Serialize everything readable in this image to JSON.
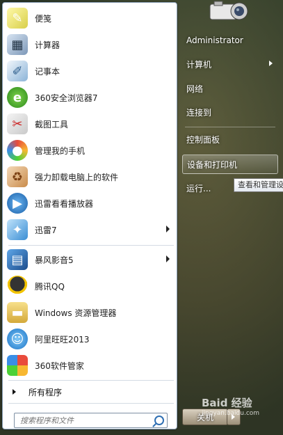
{
  "user": {
    "name": "Administrator"
  },
  "programs": [
    {
      "label": "便笺",
      "icon": "sticky-note-icon"
    },
    {
      "label": "计算器",
      "icon": "calculator-icon"
    },
    {
      "label": "记事本",
      "icon": "notepad-icon"
    },
    {
      "label": "360安全浏览器7",
      "icon": "browser-360-icon"
    },
    {
      "label": "截图工具",
      "icon": "snipping-tool-icon"
    },
    {
      "label": "管理我的手机",
      "icon": "phone-manager-icon"
    },
    {
      "label": "强力卸载电脑上的软件",
      "icon": "uninstaller-icon"
    },
    {
      "label": "迅雷看看播放器",
      "icon": "xunlei-player-icon"
    },
    {
      "label": "迅雷7",
      "icon": "xunlei-icon"
    },
    {
      "label": "暴风影音5",
      "icon": "baofeng-icon"
    },
    {
      "label": "腾讯QQ",
      "icon": "qq-icon"
    },
    {
      "label": "Windows 资源管理器",
      "icon": "explorer-icon"
    },
    {
      "label": "阿里旺旺2013",
      "icon": "aliwangwang-icon"
    },
    {
      "label": "360软件管家",
      "icon": "software-manager-icon"
    }
  ],
  "all_programs_label": "所有程序",
  "search": {
    "placeholder": "搜索程序和文件"
  },
  "right_menu": [
    {
      "label": "计算机"
    },
    {
      "label": "网络"
    },
    {
      "label": "连接到"
    },
    {
      "label": "控制面板"
    },
    {
      "label": "设备和打印机"
    },
    {
      "label": "运行..."
    }
  ],
  "tooltip": "查看和管理设",
  "shutdown_label": "关机",
  "watermark": {
    "main": "Baid 经验",
    "sub": "jingyan.baidu.com"
  }
}
